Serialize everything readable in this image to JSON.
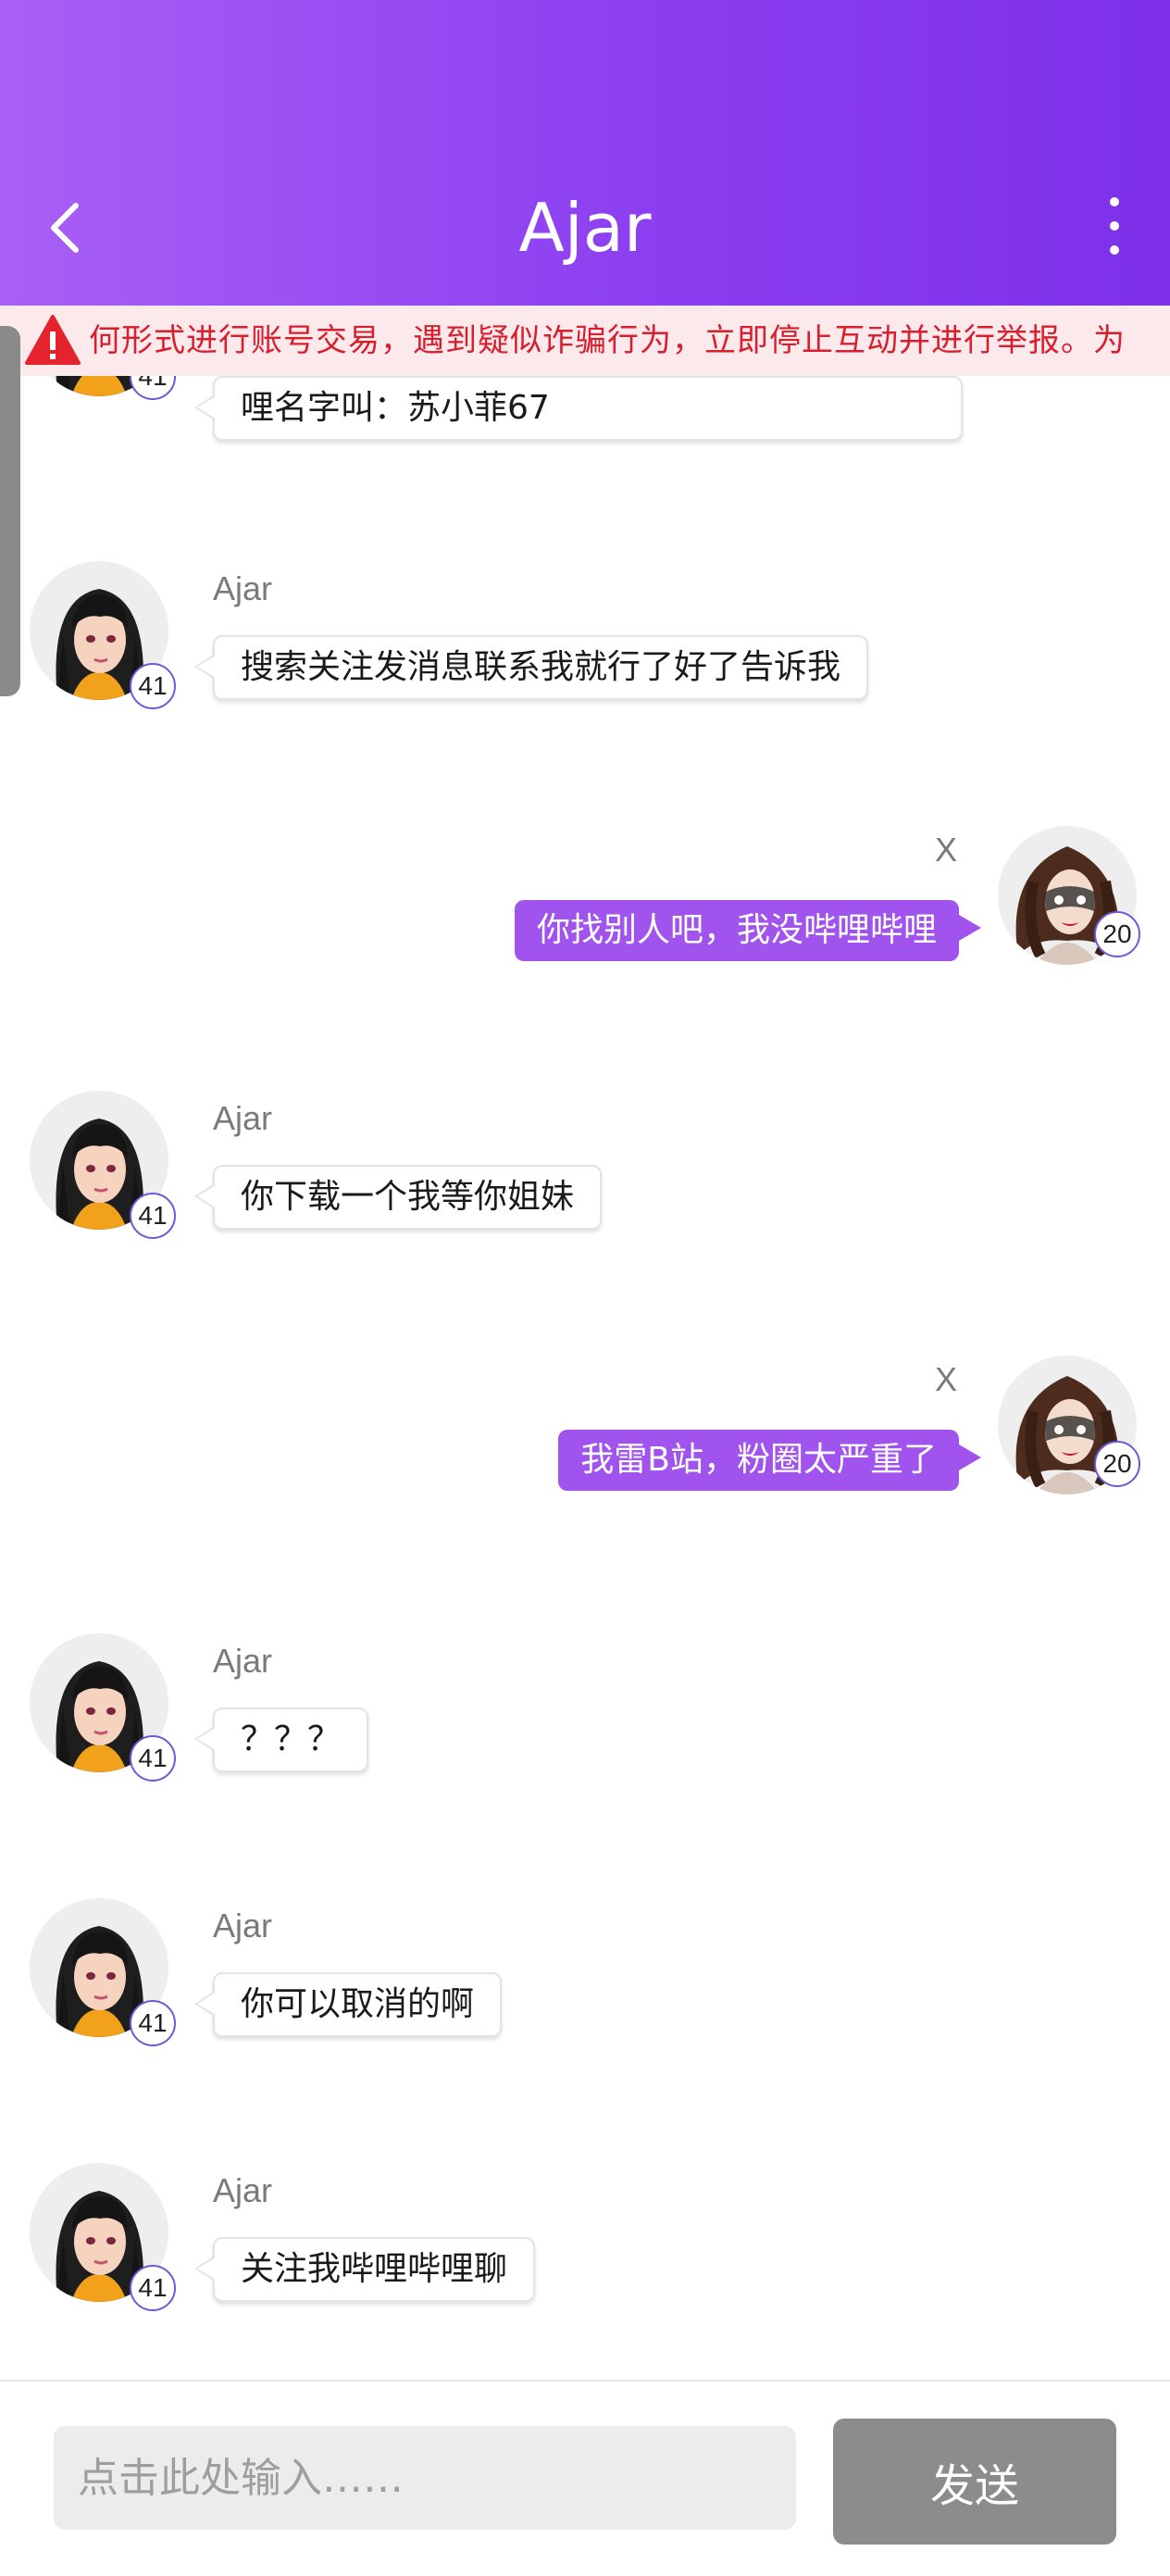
{
  "header": {
    "title": "Ajar",
    "back_icon": "chevron-left-icon",
    "more_icon": "more-vertical-icon",
    "gradient": [
      "#a960f5",
      "#7d30e8"
    ]
  },
  "warning": {
    "icon": "warning-triangle-icon",
    "text": "何形式进行账号交易，遇到疑似诈骗行为，立即停止互动并进行举报。为",
    "color": "#d71f2e"
  },
  "messages": [
    {
      "sender": "",
      "level": "41",
      "text": "哩名字叫：苏小菲67",
      "direction": "in"
    },
    {
      "sender": "Ajar",
      "level": "41",
      "text": "搜索关注发消息联系我就行了好了告诉我",
      "direction": "in"
    },
    {
      "sender": "X",
      "level": "20",
      "text": "你找别人吧，我没哔哩哔哩",
      "direction": "out"
    },
    {
      "sender": "Ajar",
      "level": "41",
      "text": "你下载一个我等你姐妹",
      "direction": "in"
    },
    {
      "sender": "X",
      "level": "20",
      "text": "我雷B站，粉圈太严重了",
      "direction": "out"
    },
    {
      "sender": "Ajar",
      "level": "41",
      "text": "？？？",
      "direction": "in"
    },
    {
      "sender": "Ajar",
      "level": "41",
      "text": "你可以取消的啊",
      "direction": "in"
    },
    {
      "sender": "Ajar",
      "level": "41",
      "text": "关注我哔哩哔哩聊",
      "direction": "in"
    }
  ],
  "composer": {
    "placeholder": "点击此处输入……",
    "send_label": "发送"
  },
  "colors": {
    "outgoing_bubble": "#a153ee",
    "send_button": "#8c8c8c"
  }
}
